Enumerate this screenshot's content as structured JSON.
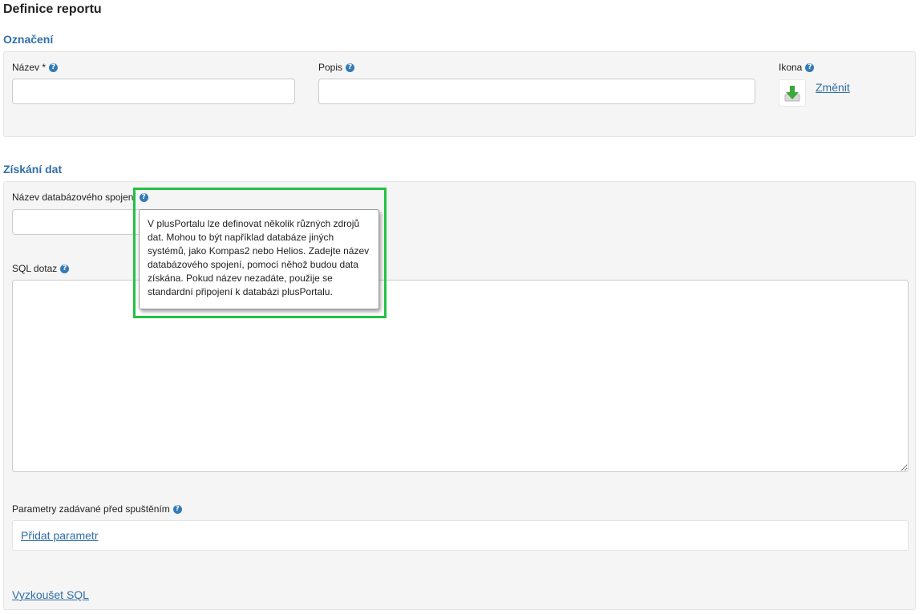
{
  "page": {
    "title": "Definice reportu"
  },
  "oznaceni": {
    "title": "Označení",
    "nazev_label": "Název *",
    "nazev_value": "",
    "popis_label": "Popis",
    "popis_value": "",
    "ikona_label": "Ikona",
    "ikona_icon": "download-arrow-icon",
    "zmenit_link": "Změnit"
  },
  "ziskani_dat": {
    "title": "Získání dat",
    "connection_label": "Název databázového spojení",
    "connection_value": "",
    "sql_label": "SQL dotaz",
    "sql_value": "",
    "params_label": "Parametry zadávané před spuštěním",
    "add_param_link": "Přidat parametr",
    "test_sql_link": "Vyzkoušet SQL"
  },
  "tooltip": {
    "text": "V plusPortalu lze definovat několik různých zdrojů dat. Mohou to být například databáze jiných systémů, jako Kompas2 nebo Helios. Zadejte název databázového spojení, pomocí něhož budou data získána. Pokud název nezadáte, použije se standardní připojení k databázi plusPortalu."
  },
  "colors": {
    "section_title": "#2f6ea8",
    "help_icon": "#337ab7",
    "highlight": "#22c244",
    "panel_bg": "#f5f5f5"
  }
}
